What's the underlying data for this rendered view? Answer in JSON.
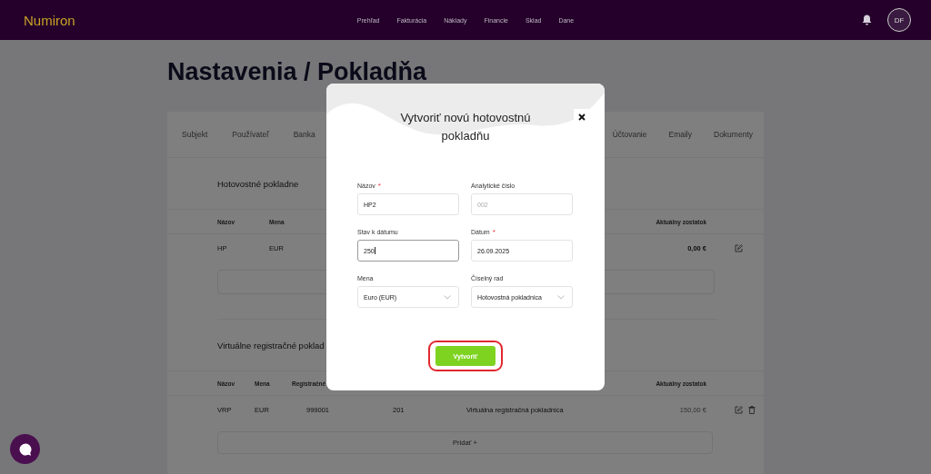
{
  "app": {
    "logo": "Numiron",
    "nav": [
      "Prehľad",
      "Fakturácia",
      "Náklady",
      "Financie",
      "Sklad",
      "Dane"
    ],
    "avatar": "DF"
  },
  "page": {
    "title": "Nastavenia / Pokladňa"
  },
  "tabs_left": [
    {
      "label": "Subjekt",
      "selected": false
    },
    {
      "label": "Používateľ",
      "selected": false
    },
    {
      "label": "Banka",
      "selected": false
    }
  ],
  "tabs_right": [
    {
      "label": "Účtovanie",
      "selected": false
    },
    {
      "label": "Emaily",
      "selected": false
    },
    {
      "label": "Dokumenty",
      "selected": false
    }
  ],
  "cash_registers": {
    "title": "Hotovostné pokladne",
    "columns": [
      "Názov",
      "Mena",
      "Aktuálny zostatok"
    ],
    "rows": [
      {
        "name": "HP",
        "currency": "EUR",
        "balance": "0,00 €",
        "editable": true,
        "deletable": false
      }
    ]
  },
  "virtual_registers": {
    "title": "Virtuálne registračné poklad",
    "columns": [
      "Názov",
      "Mena",
      "Registračné",
      "Aktuálny zostatok"
    ],
    "rows": [
      {
        "name": "VRP",
        "currency": "EUR",
        "registration": "999001",
        "number": "201",
        "type": "Virtuálna registračná pokladnica",
        "balance": "150,00 €",
        "editable": true,
        "deletable": true
      }
    ],
    "add_button": "Pridať +"
  },
  "modal": {
    "title": "Vytvoriť novú hotovostnú pokladňu",
    "fields": [
      {
        "label": "Názov",
        "required_mark": "*",
        "kind": "text",
        "value": "HP2",
        "focused": false
      },
      {
        "label": "Analytické číslo",
        "kind": "text",
        "placeholder": "002",
        "focused": false
      },
      {
        "label": "Stav k dátumu",
        "kind": "text",
        "value": "250",
        "focused": true
      },
      {
        "label": "Dátum",
        "required_mark": "*",
        "kind": "text",
        "value": "26.09.2025",
        "focused": false
      },
      {
        "label": "Mena",
        "kind": "select",
        "value": "Euro (EUR)",
        "focused": false
      },
      {
        "label": "Číselný rad",
        "kind": "select",
        "value": "Hotovostná pokladnica",
        "focused": false
      }
    ],
    "submit": "Vytvoriť"
  }
}
